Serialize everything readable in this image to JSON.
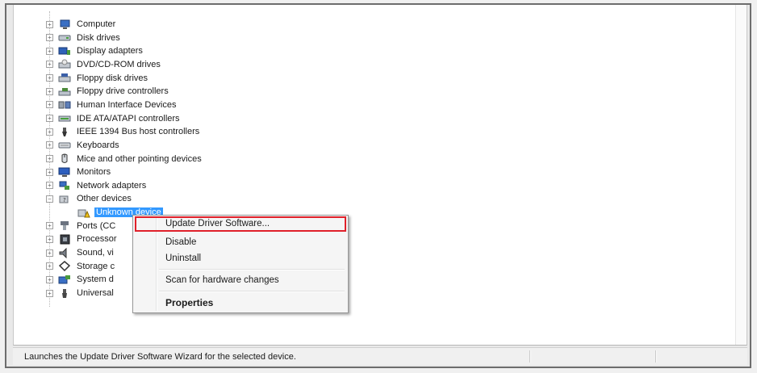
{
  "device_tree": {
    "items": [
      {
        "label": "Computer",
        "icon": "computer-icon",
        "state": "collapsed"
      },
      {
        "label": "Disk drives",
        "icon": "disk-drive-icon",
        "state": "collapsed"
      },
      {
        "label": "Display adapters",
        "icon": "display-adapter-icon",
        "state": "collapsed"
      },
      {
        "label": "DVD/CD-ROM drives",
        "icon": "dvd-drive-icon",
        "state": "collapsed"
      },
      {
        "label": "Floppy disk drives",
        "icon": "floppy-disk-icon",
        "state": "collapsed"
      },
      {
        "label": "Floppy drive controllers",
        "icon": "floppy-controller-icon",
        "state": "collapsed"
      },
      {
        "label": "Human Interface Devices",
        "icon": "hid-icon",
        "state": "collapsed"
      },
      {
        "label": "IDE ATA/ATAPI controllers",
        "icon": "ide-controller-icon",
        "state": "collapsed"
      },
      {
        "label": "IEEE 1394 Bus host controllers",
        "icon": "ieee1394-icon",
        "state": "collapsed"
      },
      {
        "label": "Keyboards",
        "icon": "keyboard-icon",
        "state": "collapsed"
      },
      {
        "label": "Mice and other pointing devices",
        "icon": "mouse-icon",
        "state": "collapsed"
      },
      {
        "label": "Monitors",
        "icon": "monitor-icon",
        "state": "collapsed"
      },
      {
        "label": "Network adapters",
        "icon": "network-adapter-icon",
        "state": "collapsed"
      },
      {
        "label": "Other devices",
        "icon": "other-devices-icon",
        "state": "expanded"
      },
      {
        "label": "Unknown device",
        "icon": "warning-device-icon",
        "state": "child-selected"
      },
      {
        "label": "Ports (CC",
        "icon": "ports-icon",
        "state": "collapsed"
      },
      {
        "label": "Processor",
        "icon": "processor-icon",
        "state": "collapsed"
      },
      {
        "label": "Sound, vi",
        "icon": "sound-icon",
        "state": "collapsed"
      },
      {
        "label": "Storage c",
        "icon": "storage-controller-icon",
        "state": "collapsed"
      },
      {
        "label": "System d",
        "icon": "system-device-icon",
        "state": "collapsed"
      },
      {
        "label": "Universal",
        "icon": "usb-icon",
        "state": "collapsed"
      }
    ]
  },
  "context_menu": {
    "update_driver": "Update Driver Software...",
    "disable": "Disable",
    "uninstall": "Uninstall",
    "scan": "Scan for hardware changes",
    "properties": "Properties"
  },
  "status_bar": {
    "text": "Launches the Update Driver Software Wizard for the selected device."
  },
  "colors": {
    "selection": "#3399ff",
    "highlight_box": "#e0202a"
  }
}
